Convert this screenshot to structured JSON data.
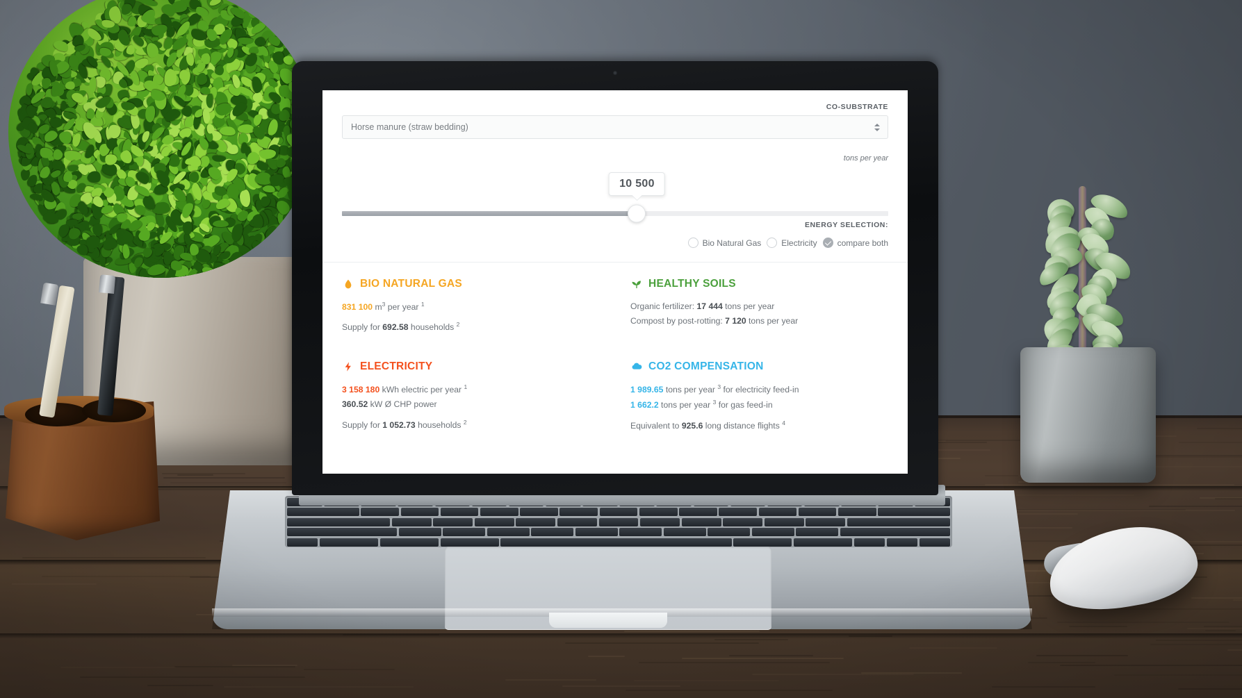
{
  "app": {
    "co_substrate_label": "CO-SUBSTRATE",
    "energy_selection_label": "ENERGY SELECTION:"
  },
  "substrate_select": {
    "value": "Horse manure (straw bedding)",
    "icon": "chevron-updown-icon"
  },
  "slider": {
    "value": "10 500",
    "units": "tons per year",
    "fill_percent": 54
  },
  "energy_options": [
    {
      "label": "Bio Natural Gas",
      "checked": false
    },
    {
      "label": "Electricity",
      "checked": false
    },
    {
      "label": "compare both",
      "checked": true
    }
  ],
  "cards": [
    {
      "id": "bio-natural-gas",
      "title": "BIO NATURAL GAS",
      "icon": "flame-drop-icon",
      "color": "#F5A623",
      "lines": [
        {
          "accent": "831 100",
          "unit_html": " m",
          "sup_unit": "3",
          "rest": " per year ",
          "footnote": "1"
        },
        {
          "pre": "Supply for ",
          "bold": "692.58",
          "rest": " households ",
          "footnote": "2",
          "spaced": true
        }
      ]
    },
    {
      "id": "healthy-soils",
      "title": "HEALTHY SOILS",
      "icon": "sprout-icon",
      "color": "#4BA03C",
      "lines": [
        {
          "pre": "Organic fertilizer: ",
          "bold": "17 444",
          "rest": " tons per year"
        },
        {
          "pre": "Compost by post-rotting: ",
          "bold": "7 120",
          "rest": " tons per year"
        }
      ]
    },
    {
      "id": "electricity",
      "title": "ELECTRICITY",
      "icon": "lightning-bolt-icon",
      "color": "#F4511E",
      "lines": [
        {
          "accent": "3 158 180",
          "rest": " kWh electric per year ",
          "footnote": "1"
        },
        {
          "bold": "360.52",
          "rest": " kW Ø CHP power"
        },
        {
          "pre": "Supply for ",
          "bold": "1 052.73",
          "rest": " households ",
          "footnote": "2",
          "spaced": true
        }
      ]
    },
    {
      "id": "co2-compensation",
      "title": "CO2 COMPENSATION",
      "icon": "cloud-icon",
      "color": "#36B5E8",
      "lines": [
        {
          "accent": "1 989.65",
          "rest": " tons per year ",
          "footnote": "3",
          "tail": " for electricity feed-in"
        },
        {
          "accent": "1 662.2",
          "rest": " tons per year ",
          "footnote": "3",
          "tail": " for gas feed-in"
        },
        {
          "pre": "Equivalent to ",
          "bold": "925.6",
          "rest": " long distance flights ",
          "footnote": "4",
          "spaced": true
        }
      ]
    }
  ]
}
